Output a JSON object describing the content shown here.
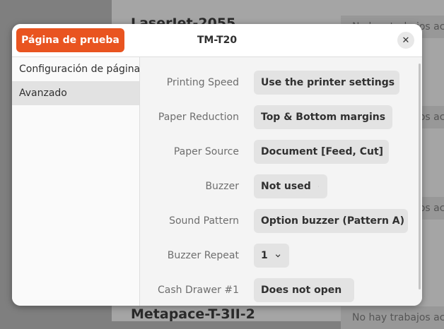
{
  "background": {
    "printers": [
      {
        "name": "LaserJet-2055",
        "status": "No hay trabajos activos"
      },
      {
        "name": "",
        "status": "No hay trabajos activos"
      },
      {
        "name": "",
        "status": "No hay trabajos activos"
      },
      {
        "name": "Metapace-T-3II-2",
        "status": "No hay trabajos activos"
      }
    ]
  },
  "dialog": {
    "title": "TM-T20",
    "test_page_label": "Página de prueba",
    "close_glyph": "✕",
    "accent_color": "#e95420"
  },
  "sidebar": {
    "items": [
      {
        "label": "Configuración de página",
        "selected": false
      },
      {
        "label": "Avanzado",
        "selected": true
      }
    ]
  },
  "settings": [
    {
      "label": "Printing Speed",
      "value": "Use the printer settings"
    },
    {
      "label": "Paper Reduction",
      "value": "Top & Bottom margins"
    },
    {
      "label": "Paper Source",
      "value": "Document [Feed, Cut]"
    },
    {
      "label": "Buzzer",
      "value": "Not used"
    },
    {
      "label": "Sound Pattern",
      "value": "Option buzzer (Pattern A)"
    },
    {
      "label": "Buzzer Repeat",
      "value": "1"
    },
    {
      "label": "Cash Drawer #1",
      "value": "Does not open"
    }
  ]
}
